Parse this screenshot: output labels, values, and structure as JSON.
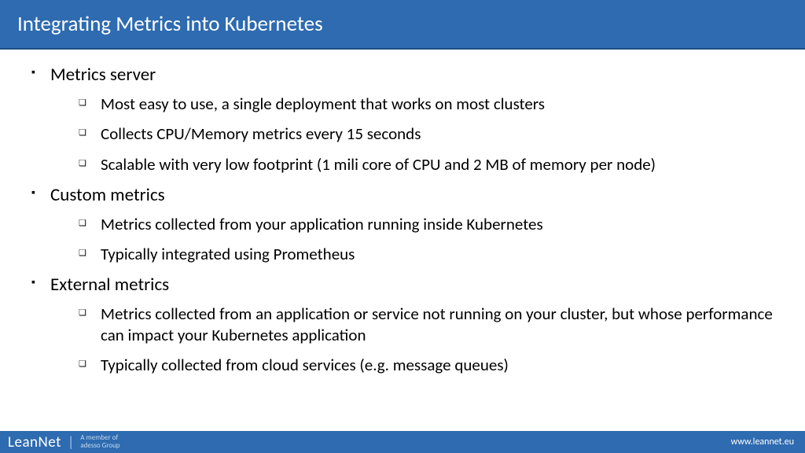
{
  "title": "Integrating Metrics into Kubernetes",
  "sections": [
    {
      "heading": "Metrics server",
      "items": [
        "Most easy to use, a single deployment that works on most clusters",
        "Collects CPU/Memory metrics every 15 seconds",
        "Scalable with very low footprint (1 mili core of CPU and 2 MB of memory per node)"
      ]
    },
    {
      "heading": "Custom metrics",
      "items": [
        "Metrics collected from your application running inside Kubernetes",
        "Typically integrated using Prometheus"
      ]
    },
    {
      "heading": "External metrics",
      "items": [
        "Metrics collected from an application or service not running on your cluster, but whose performance can impact your Kubernetes application",
        "Typically collected from cloud services (e.g. message queues)"
      ]
    }
  ],
  "footer": {
    "logo": "LeanNet",
    "tagline_line1": "A member of",
    "tagline_line2": "adesso Group",
    "url": "www.leannet.eu"
  }
}
